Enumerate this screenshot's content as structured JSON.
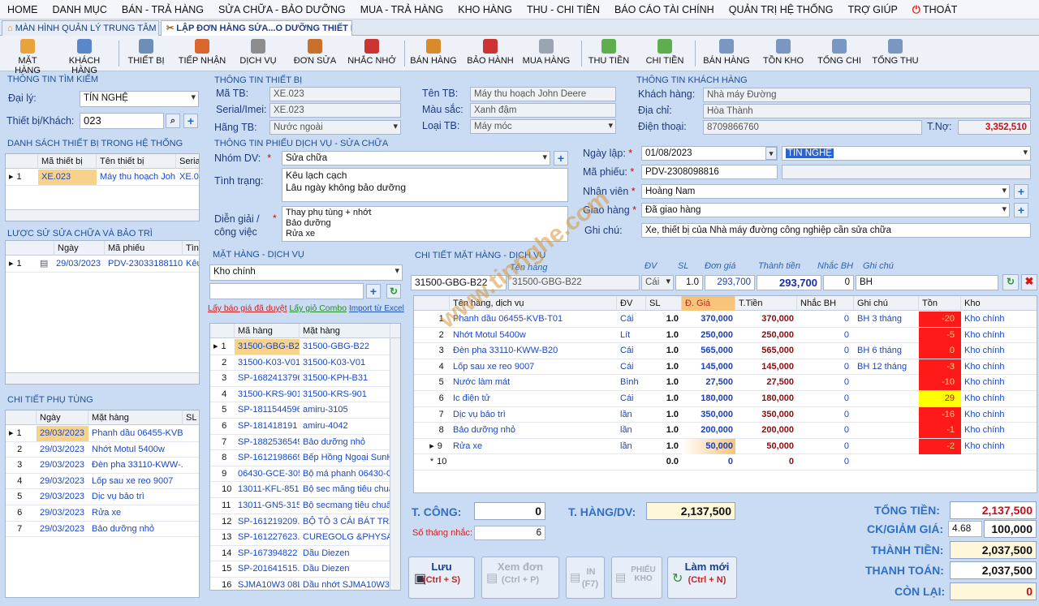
{
  "menu": [
    "HOME",
    "DANH MỤC",
    "BÁN - TRẢ HÀNG",
    "SỬA CHỮA - BẢO DƯỠNG",
    "MUA - TRẢ HÀNG",
    "KHO HÀNG",
    "THU - CHI TIỀN",
    "BÁO CÁO TÀI CHÍNH",
    "QUẢN TRỊ HỆ THỐNG",
    "TRỢ GIÚP",
    "THOÁT"
  ],
  "tabs": [
    "MÀN HÌNH QUẢN LÝ TRUNG TÂM",
    "LẬP ĐƠN HÀNG SỬA...O DƯỠNG THIẾT BỊ"
  ],
  "toolbar": [
    "MẶT HÀNG",
    "KHÁCH HÀNG",
    "THIẾT BỊ",
    "TIẾP NHẬN",
    "DỊCH VỤ",
    "ĐƠN SỬA",
    "NHẮC NHỞ",
    "BÁN HÀNG",
    "BẢO HÀNH",
    "MUA HÀNG",
    "THU TIỀN",
    "CHI TIỀN",
    "BÁN HÀNG",
    "TỒN KHO",
    "TỔNG CHI",
    "TỔNG THU"
  ],
  "search": {
    "section": "THÔNG TIN TÌM KIẾM",
    "dealer_label": "Đại lý:",
    "dealer": "TÍN NGHỆ",
    "device_label": "Thiết bị/Khách:",
    "device": "023"
  },
  "device_list": {
    "section": "DANH SÁCH THIẾT BỊ TRONG HỆ THỐNG",
    "headers": [
      "Mã thiết bị",
      "Tên thiết bị",
      "Serial/"
    ],
    "rows": [
      [
        "1",
        "XE.023",
        "Máy thu hoạch Joh...",
        "XE.023"
      ]
    ]
  },
  "history": {
    "section": "LƯỢC SỬ SỬA CHỮA VÀ BẢO TRÌ",
    "headers": [
      "Ngày",
      "Mã phiếu",
      "Tình"
    ],
    "rows": [
      [
        "1",
        "29/03/2023",
        "PDV-23033188110",
        "Kêu l"
      ]
    ]
  },
  "parts": {
    "section": "CHI TIẾT PHỤ TÙNG",
    "headers": [
      "Ngày",
      "Mặt hàng",
      "SL"
    ],
    "rows": [
      [
        "1",
        "29/03/2023",
        "Phanh dầu 06455-KVB-..."
      ],
      [
        "2",
        "29/03/2023",
        "Nhớt Motul 5400w"
      ],
      [
        "3",
        "29/03/2023",
        "Đèn pha 33110-KWW-..."
      ],
      [
        "4",
        "29/03/2023",
        "Lốp sau xe reo 9007"
      ],
      [
        "5",
        "29/03/2023",
        "Dịc vụ bảo trì"
      ],
      [
        "6",
        "29/03/2023",
        "Rửa xe"
      ],
      [
        "7",
        "29/03/2023",
        "Bảo dưỡng nhỏ"
      ]
    ]
  },
  "device_info": {
    "section": "THÔNG TIN THIẾT BỊ",
    "code_label": "Mã TB:",
    "code": "XE.023",
    "serial_label": "Serial/Imei:",
    "serial": "XE.023",
    "brand_label": "Hãng TB:",
    "brand": "Nước ngoài",
    "name_label": "Tên TB:",
    "name": "Máy thu hoạch John Deere",
    "color_label": "Màu sắc:",
    "color": "Xanh đậm",
    "type_label": "Loại TB:",
    "type": "Máy móc"
  },
  "customer": {
    "section": "THÔNG TIN KHÁCH HÀNG",
    "name_label": "Khách hàng:",
    "name": "Nhà máy Đường",
    "addr_label": "Địa chỉ:",
    "addr": "Hòa Thành",
    "phone_label": "Điện thoại:",
    "phone": "8709866760",
    "debt_label": "T.Nợ:",
    "debt": "3,352,510"
  },
  "ticket": {
    "section": "THÔNG TIN PHIẾU DỊCH VỤ - SỬA CHỮA",
    "group_label": "Nhóm DV:",
    "group": "Sửa chữa",
    "status_label": "Tình trạng:",
    "status1": "Kêu lạch cạch",
    "status2": "Lâu ngày không bảo dưỡng",
    "desc_label1": "Diễn giải /",
    "desc_label2": "công việc",
    "desc1": "Thay phụ tùng + nhớt",
    "desc2": "Bảo dưỡng",
    "desc3": "Rửa xe",
    "date_label": "Ngày lập:",
    "date": "01/08/2023",
    "branch": "TÍN NGHỆ",
    "code_label": "Mã phiếu:",
    "code": "PDV-2308098816",
    "staff_label": "Nhân viên",
    "staff": "Hoàng Nam",
    "delivery_label": "Giao hàng",
    "delivery": "Đã giao hàng",
    "note_label": "Ghi chú:",
    "note": "Xe, thiết bị của Nhà máy đường công nghiệp cần sửa chữa"
  },
  "items": {
    "section": "MẶT HÀNG - DỊCH VỤ",
    "warehouse": "Kho chính",
    "link1": "Lấy báo giá đã duyệt",
    "link2": "Lấy giỏ Combo",
    "link3": "Import từ Excel",
    "headers": [
      "Mã hàng",
      "Mặt hàng"
    ],
    "rows": [
      [
        "1",
        "31500-GBG-B22",
        "31500-GBG-B22"
      ],
      [
        "2",
        "31500-K03-V01",
        "31500-K03-V01"
      ],
      [
        "3",
        "SP-1682413796",
        "31500-KPH-B31"
      ],
      [
        "4",
        "31500-KRS-901",
        "31500-KRS-901"
      ],
      [
        "5",
        "SP-1811544596",
        "amiru-3105"
      ],
      [
        "6",
        "SP-181418191",
        "amiru-4042"
      ],
      [
        "7",
        "SP-1882536549",
        "Bảo dưỡng nhỏ"
      ],
      [
        "8",
        "SP-1612198669",
        "Bếp Hồng Ngoại SunHou"
      ],
      [
        "9",
        "06430-GCE-305",
        "Bộ má phanh 06430-GCE"
      ],
      [
        "10",
        "13011-KFL-851",
        "Bộ sec măng tiêu chuẩn"
      ],
      [
        "11",
        "13011-GN5-315",
        "Bộ secmang tiêu chuẩn"
      ],
      [
        "12",
        "SP-161219209...",
        "BỘ TÔ 3 CÁI BÁT TRÀNG"
      ],
      [
        "13",
        "SP-161227623...",
        "CUREGOLG &PHYSAN"
      ],
      [
        "14",
        "SP-167394822",
        "Dầu Diezen"
      ],
      [
        "15",
        "SP-201641515...",
        "Dầu Diezen"
      ],
      [
        "16",
        "SJMA10W3 08L",
        "Dầu nhớt SJMA10W3 08L"
      ]
    ]
  },
  "detail": {
    "section": "CHI TIẾT MẶT HÀNG - DỊCH VỤ",
    "h_name": "Tên hàng",
    "h_unit": "ĐV",
    "h_qty": "SL",
    "h_price": "Đơn giá",
    "h_total": "Thành tiền",
    "h_remind": "Nhắc BH",
    "h_note": "Ghi chú",
    "e_code": "31500-GBG-B22",
    "e_name": "31500-GBG-B22",
    "e_unit": "Cái",
    "e_qty": "1.0",
    "e_price": "293,700",
    "e_total": "293,700",
    "e_remind": "0",
    "e_note": "BH",
    "headers": [
      "Tên hàng, dịch vụ",
      "ĐV",
      "SL",
      "Đ. Giá",
      "T.Tiền",
      "Nhắc BH",
      "Ghi chú",
      "Tồn",
      "Kho"
    ],
    "rows": [
      [
        "1",
        "Phanh dầu 06455-KVB-T01",
        "Cái",
        "1.0",
        "370,000",
        "370,000",
        "0",
        "BH 3 tháng",
        "-20",
        "Kho chính"
      ],
      [
        "2",
        "Nhớt Motul 5400w",
        "Lít",
        "1.0",
        "250,000",
        "250,000",
        "0",
        "",
        "-5",
        "Kho chính"
      ],
      [
        "3",
        "Đèn pha 33110-KWW-B20",
        "Cái",
        "1.0",
        "565,000",
        "565,000",
        "0",
        "BH 6 tháng",
        "0",
        "Kho chính"
      ],
      [
        "4",
        "Lốp sau xe reo 9007",
        "Cái",
        "1.0",
        "145,000",
        "145,000",
        "0",
        "BH 12 tháng",
        "-3",
        "Kho chính"
      ],
      [
        "5",
        "Nước làm mát",
        "Bình",
        "1.0",
        "27,500",
        "27,500",
        "0",
        "",
        "-10",
        "Kho chính"
      ],
      [
        "6",
        "Ic điện tử",
        "Cái",
        "1.0",
        "180,000",
        "180,000",
        "0",
        "",
        "29",
        "Kho chính"
      ],
      [
        "7",
        "Dịc vụ bảo trì",
        "lần",
        "1.0",
        "350,000",
        "350,000",
        "0",
        "",
        "-16",
        "Kho chính"
      ],
      [
        "8",
        "Bảo dưỡng nhỏ",
        "lần",
        "1.0",
        "200,000",
        "200,000",
        "0",
        "",
        "-1",
        "Kho chính"
      ],
      [
        "9",
        "Rửa xe",
        "lần",
        "1.0",
        "50,000",
        "50,000",
        "0",
        "",
        "-2",
        "Kho chính"
      ]
    ],
    "new_row": [
      "10",
      "",
      "",
      "0.0",
      "0",
      "0",
      "0",
      "",
      "",
      ""
    ]
  },
  "totals": {
    "labor_label": "T. CÔNG:",
    "labor": "0",
    "months_label": "Số tháng nhắc:",
    "months": "6",
    "goods_label": "T. HÀNG/DV:",
    "goods": "2,137,500",
    "sum_label": "TỔNG TIỀN:",
    "sum": "2,137,500",
    "disc_label": "CK/GIẢM GIÁ:",
    "disc_pct": "4.68",
    "disc": "100,000",
    "final_label": "THÀNH TIỀN:",
    "final": "2,037,500",
    "pay_label": "THANH TOÁN:",
    "pay": "2,037,500",
    "remain_label": "CÒN LẠI:",
    "remain": "0"
  },
  "actions": {
    "save": "Lưu",
    "save_k": "(Ctrl + S)",
    "view": "Xem đơn",
    "view_k": "(Ctrl + P)",
    "print": "IN",
    "print_k": "(F7)",
    "stock1": "PHIẾU",
    "stock2": "KHO",
    "new": "Làm mới",
    "new_k": "(Ctrl + N)"
  },
  "watermark": "www.tinnghe.com"
}
